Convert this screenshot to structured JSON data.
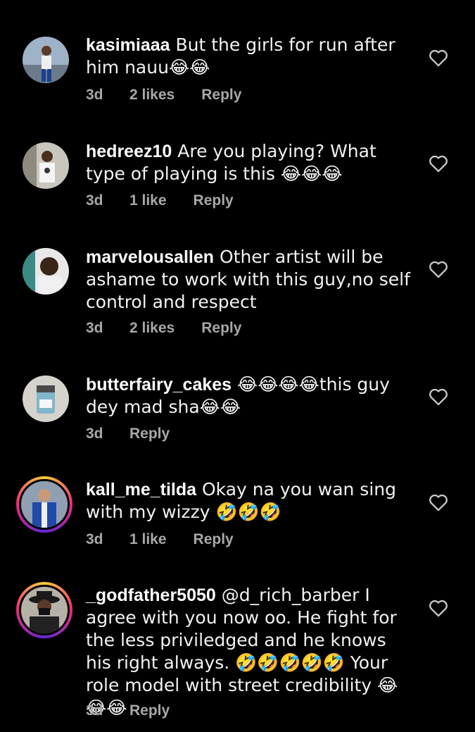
{
  "comments": [
    {
      "username": "kasimiaaa",
      "text": " But the girls for run after him nauu😂😂",
      "time": "3d",
      "likes": "2 likes",
      "reply": "Reply"
    },
    {
      "username": "hedreez10",
      "text": " Are you playing? What type of playing is this 😂😂😂",
      "time": "3d",
      "likes": "1 like",
      "reply": "Reply"
    },
    {
      "username": "marvelousallen",
      "text": " Other artist will be ashame to work with this guy,no self control and respect",
      "time": "3d",
      "likes": "2 likes",
      "reply": "Reply"
    },
    {
      "username": "butterfairy_cakes",
      "text": " 😂😂😂😂this guy dey mad sha😂😂",
      "time": "3d",
      "likes": "",
      "reply": "Reply"
    },
    {
      "username": "kall_me_tilda",
      "text": " Okay na you wan sing with my wizzy 🤣🤣🤣",
      "time": "3d",
      "likes": "1 like",
      "reply": "Reply"
    },
    {
      "username": "_godfather5050",
      "text": " @d_rich_barber I agree with you now oo. He fight for the less priviledged and he knows his right always. 🤣🤣🤣🤣🤣 Your role model with street credibility 😂😂😂",
      "time": "3d",
      "likes": "",
      "reply": "Reply"
    }
  ],
  "icons": {
    "like": "heart-outline-icon"
  },
  "colors": {
    "background": "#000000",
    "text": "#f2f2f2",
    "meta": "#a8a8a8"
  }
}
